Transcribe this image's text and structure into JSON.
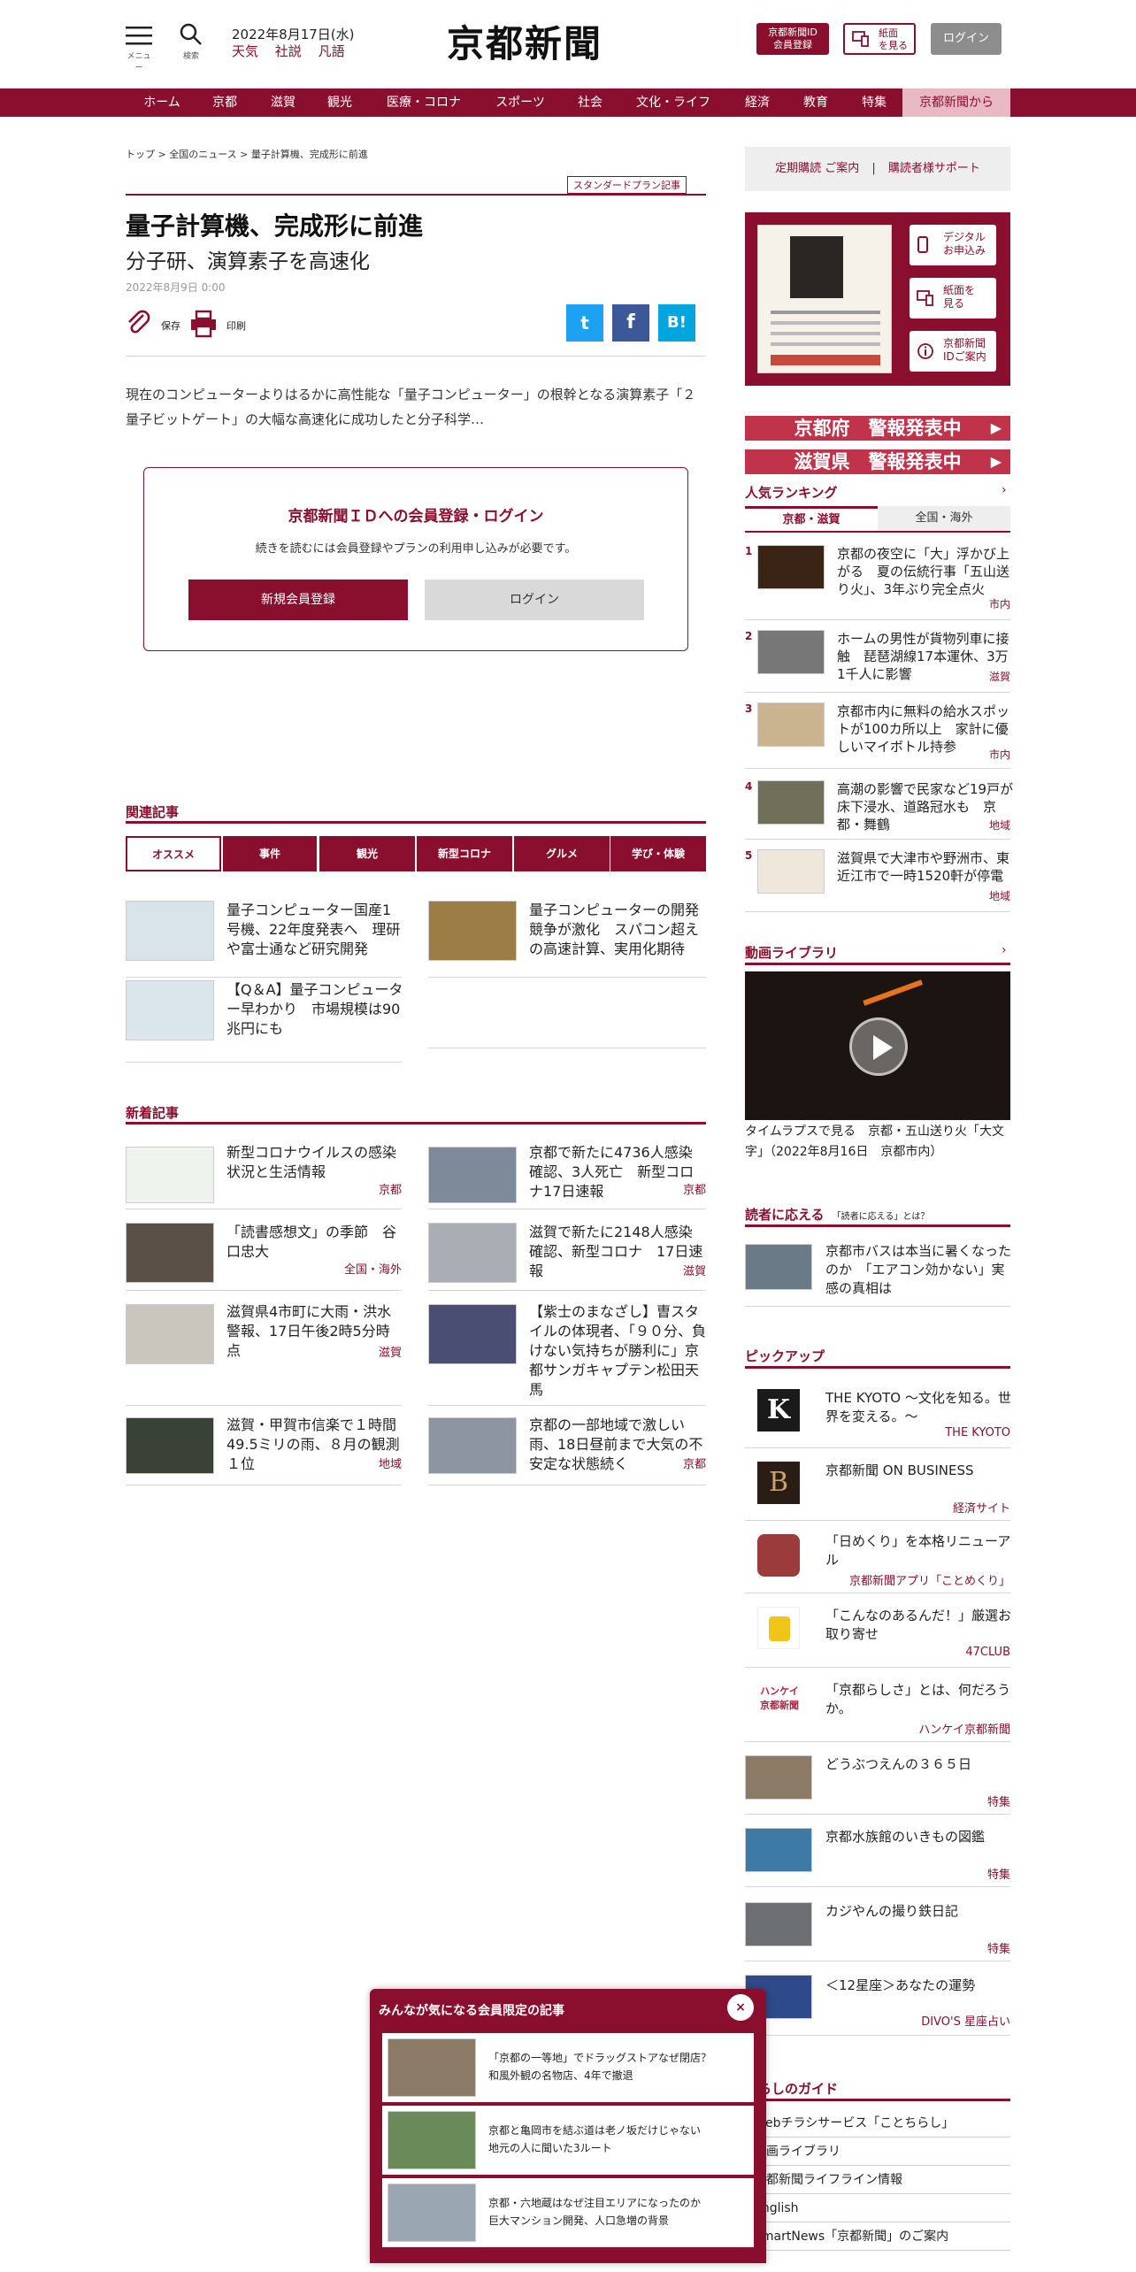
{
  "header": {
    "menu_label": "メニュー",
    "search_label": "検索",
    "date": "2022年8月17日(水)",
    "links": [
      "天気",
      "社説",
      "凡語"
    ],
    "logo": "京都新聞",
    "id_button": [
      "京都新聞ID",
      "会員登録"
    ],
    "paper_button": [
      "紙面",
      "を見る"
    ],
    "login": "ログイン"
  },
  "nav": [
    "ホーム",
    "京都",
    "滋賀",
    "観光",
    "医療・コロナ",
    "スポーツ",
    "社会",
    "文化・ライフ",
    "経済",
    "教育",
    "特集",
    "京都新聞から"
  ],
  "breadcrumb": [
    "トップ",
    "全国のニュース",
    "量子計算機、完成形に前進"
  ],
  "article": {
    "plan_badge": "スタンダードプラン記事",
    "title": "量子計算機、完成形に前進",
    "subtitle": "分子研、演算素子を高速化",
    "date": "2022年8月9日 0:00",
    "save": "保存",
    "print": "印刷",
    "share": [
      "t",
      "f",
      "B!"
    ],
    "lead": "現在のコンピューターよりはるかに高性能な「量子コンピューター」の根幹となる演算素子「２量子ビットゲート」の大幅な高速化に成功したと分子科学…"
  },
  "paywall": {
    "title": "京都新聞ＩＤへの会員登録・ログイン",
    "text": "続きを読むには会員登録やプランの利用申し込みが必要です。",
    "register": "新規会員登録",
    "login": "ログイン"
  },
  "related": {
    "title": "関連記事",
    "tabs": [
      "オススメ",
      "事件",
      "観光",
      "新型コロナ",
      "グルメ",
      "学び・体験"
    ],
    "items": [
      "量子コンピューター国産1号機、22年度発表へ　理研や富士通など研究開発",
      "量子コンピューターの開発競争が激化　スパコン超えの高速計算、実用化期待",
      "【Q＆A】量子コンピューター早わかり　市場規模は90兆円にも"
    ]
  },
  "latest": {
    "title": "新着記事",
    "items": [
      {
        "title": "新型コロナウイルスの感染状況と生活情報",
        "tag": "京都"
      },
      {
        "title": "京都で新たに4736人感染確認、3人死亡　新型コロナ17日速報",
        "tag": "京都"
      },
      {
        "title": "「読書感想文」の季節　谷口忠大",
        "tag": "全国・海外"
      },
      {
        "title": "滋賀で新たに2148人感染確認、新型コロナ　17日速報",
        "tag": "滋賀"
      },
      {
        "title": "滋賀県4市町に大雨・洪水警報、17日午後2時5分時点",
        "tag": "滋賀"
      },
      {
        "title": "【紫士のまなざし】曺スタイルの体現者、「９０分、負けない気持ちが勝利に」京都サンガキャプテン松田天馬",
        "tag": ""
      },
      {
        "title": "滋賀・甲賀市信楽で１時間49.5ミリの雨、８月の観測１位",
        "tag": "地域"
      },
      {
        "title": "京都の一部地域で激しい雨、18日昼前まで大気の不安定な状態続く",
        "tag": "京都"
      }
    ]
  },
  "sidebar": {
    "subscribe": "定期購読 ご案内",
    "support": "購読者様サポート",
    "paper_btns": [
      [
        "デジタル",
        "お申込み"
      ],
      [
        "紙面を",
        "見る"
      ],
      [
        "京都新聞",
        "IDご案内"
      ]
    ],
    "alerts": [
      "京都府　警報発表中",
      "滋賀県　警報発表中"
    ],
    "ranking": {
      "title": "人気ランキング",
      "tabs": [
        "京都・滋賀",
        "全国・海外"
      ],
      "items": [
        {
          "num": "1",
          "title": "京都の夜空に「大」浮かび上がる　夏の伝統行事「五山送り火」、3年ぶり完全点火",
          "tag": "市内"
        },
        {
          "num": "2",
          "title": "ホームの男性が貨物列車に接触　琵琶湖線17本運休、3万1千人に影響",
          "tag": "滋賀"
        },
        {
          "num": "3",
          "title": "京都市内に無料の給水スポットが100カ所以上　家計に優しいマイボトル持参",
          "tag": "市内"
        },
        {
          "num": "4",
          "title": "高潮の影響で民家など19戸が床下浸水、道路冠水も　京都・舞鶴",
          "tag": "地域"
        },
        {
          "num": "5",
          "title": "滋賀県で大津市や野洲市、東近江市で一時1520軒が停電",
          "tag": "地域"
        }
      ]
    },
    "video": {
      "title": "動画ライブラリ",
      "caption": "タイムラプスで見る　京都・五山送り火「大文字」（2022年8月16日　京都市内）"
    },
    "answer": {
      "title": "読者に応える",
      "sub": "「読者に応える」とは？",
      "item": "京都市バスは本当に暑くなったのか　「エアコン効かない」実感の真相は"
    },
    "pickup": {
      "title": "ピックアップ",
      "items": [
        {
          "title": "THE KYOTO ～文化を知る。世界を変える。～",
          "tag": "THE KYOTO"
        },
        {
          "title": "京都新聞 ON BUSINESS",
          "tag": "経済サイト"
        },
        {
          "title": "「日めくり」を本格リニューアル",
          "tag": "京都新聞アプリ「ことめくり」"
        },
        {
          "title": "「こんなのあるんだ！」厳選お取り寄せ",
          "tag": "47CLUB"
        },
        {
          "title": "「京都らしさ」とは、何だろうか。",
          "tag": "ハンケイ京都新聞"
        },
        {
          "title": "どうぶつえんの３６５日",
          "tag": "特集"
        },
        {
          "title": "京都水族館のいきもの図鑑",
          "tag": "特集"
        },
        {
          "title": "カジやんの撮り鉄日記",
          "tag": "特集"
        },
        {
          "title": "＜12星座＞あなたの運勢",
          "tag": "DIVO'S 星座占い"
        }
      ]
    },
    "guide": {
      "title": "暮らしのガイド",
      "items": [
        "Webチラシサービス「ことちらし」",
        "動画ライブラリ",
        "京都新聞ライフライン情報",
        "English",
        "SmartNews「京都新聞」のご案内"
      ]
    }
  },
  "popup": {
    "title": "みんなが気になる会員限定の記事",
    "items": [
      "「京都の一等地」でドラッグストアなぜ閉店？\n和風外観の名物店、4年で撤退",
      "京都と亀岡市を結ぶ道は老ノ坂だけじゃない\n地元の人に聞いた3ルート",
      "京都・六地蔵はなぜ注目エリアになったのか\n巨大マンション開発、人口急増の背景"
    ]
  },
  "colors": {
    "brand": "#8a0f2e",
    "alert": "#c1334a",
    "twitter": "#1da1f2",
    "facebook": "#3b5998",
    "hatena": "#00a4de"
  }
}
